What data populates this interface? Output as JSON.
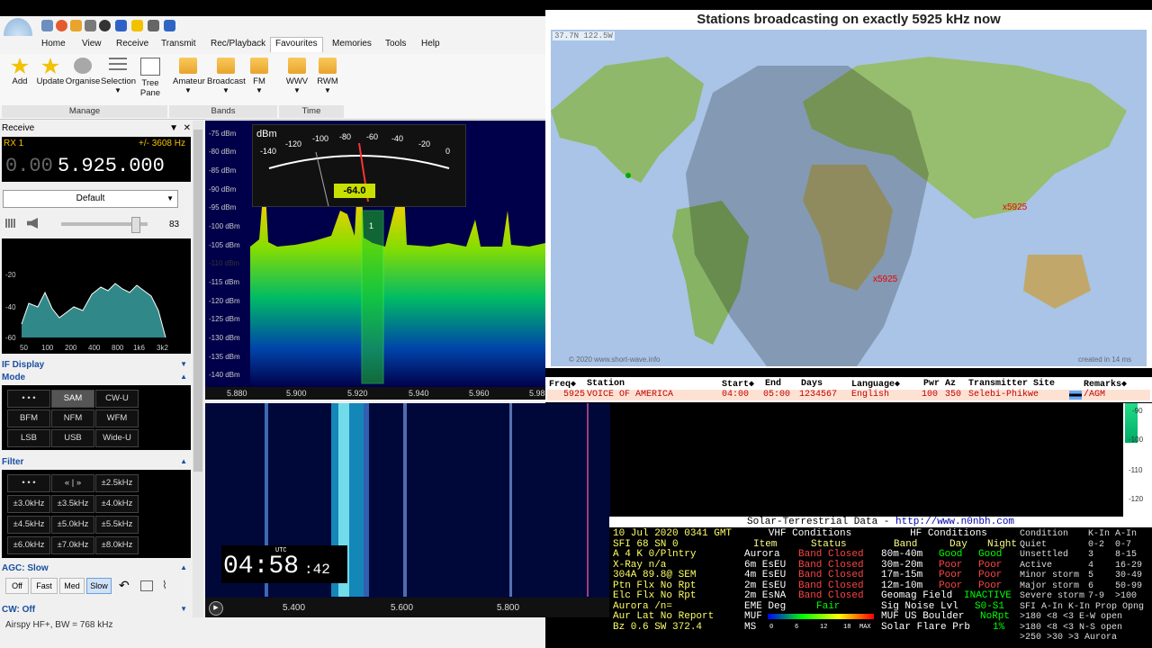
{
  "ribbon": {
    "tabs": [
      "Home",
      "View",
      "Receive",
      "Transmit",
      "Rec/Playback",
      "Favourites",
      "Memories",
      "Tools",
      "Help"
    ],
    "buttons": [
      {
        "label": "Add"
      },
      {
        "label": "Update"
      },
      {
        "label": "Organise"
      },
      {
        "label": "Selection"
      },
      {
        "label": "Tree Pane"
      },
      {
        "label": "Amateur"
      },
      {
        "label": "Broadcast"
      },
      {
        "label": "FM"
      },
      {
        "label": "WWV"
      },
      {
        "label": "RWM"
      }
    ],
    "groups": [
      "Manage",
      "Bands",
      "Time"
    ]
  },
  "receive": {
    "title": "Receive",
    "rx": "RX 1",
    "offset": "+/- 3608 Hz",
    "freq_dim": "0.00",
    "freq_main": "5.925.000",
    "profile": "Default",
    "volume": "83",
    "mini_y_labels": [
      "-20",
      "-40",
      "-60"
    ],
    "mini_x_labels": [
      "50",
      "100",
      "200",
      "400",
      "800",
      "1k6",
      "3k2"
    ]
  },
  "if_display": {
    "title": "IF Display"
  },
  "mode": {
    "title": "Mode",
    "buttons": [
      "• • •",
      "SAM",
      "CW-U",
      "BFM",
      "NFM",
      "WFM",
      "LSB",
      "USB",
      "Wide-U"
    ]
  },
  "filter": {
    "title": "Filter",
    "buttons": [
      "• • •",
      "« | »",
      "±2.5kHz",
      "±3.0kHz",
      "±3.5kHz",
      "±4.0kHz",
      "±4.5kHz",
      "±5.0kHz",
      "±5.5kHz",
      "±6.0kHz",
      "±7.0kHz",
      "±8.0kHz"
    ]
  },
  "agc": {
    "title": "AGC: Slow",
    "buttons": [
      "Off",
      "Fast",
      "Med",
      "Slow"
    ]
  },
  "cw": {
    "title": "CW: Off"
  },
  "statusbar": {
    "text": "Airspy HF+, BW = 768 kHz"
  },
  "spectrum": {
    "dbm_labels": [
      "-75 dBm",
      "-80 dBm",
      "-85 dBm",
      "-90 dBm",
      "-95 dBm",
      "-100 dBm",
      "-105 dBm",
      "-110 dBm",
      "-115 dBm",
      "-120 dBm",
      "-125 dBm",
      "-130 dBm",
      "-135 dBm",
      "-140 dBm"
    ],
    "freq_labels": [
      "5.880",
      "5.900",
      "5.920",
      "5.940",
      "5.960",
      "5.98"
    ],
    "meter_unit": "dBm",
    "meter_scale": [
      "-140",
      "-120",
      "-100",
      "-80",
      "-60",
      "-40",
      "-20",
      "0"
    ],
    "meter_value": "-64.0",
    "channel_marker": "1"
  },
  "waterfall": {
    "freq_labels": [
      "5.400",
      "5.600",
      "5.800"
    ],
    "scale_labels": [
      "-90",
      "-100",
      "-110",
      "-120"
    ]
  },
  "clock": {
    "utc": "UTC",
    "hhmm": "04:58",
    "ss": ":42"
  },
  "map": {
    "title": "Stations broadcasting on exactly 5925 kHz now",
    "coords": "37.7N 122.5W",
    "markers": [
      "x5925",
      "x5925"
    ],
    "credit": "© 2020 www.short-wave.info",
    "created": "created in 14 ms"
  },
  "station_table": {
    "headers": [
      "Freq◆",
      "Station",
      "Start◆",
      "End",
      "Days",
      "Language◆",
      "Pwr",
      "Az",
      "Transmitter Site",
      "Remarks◆"
    ],
    "row": [
      "5925",
      "VOICE OF AMERICA",
      "04:00",
      "05:00",
      "1234567",
      "English",
      "100",
      "350",
      "Selebi-Phikwe",
      "/AGM"
    ]
  },
  "solar": {
    "title": "Solar-Terrestrial Data - ",
    "url": "http://www.n0nbh.com",
    "left": [
      "10 Jul 2020 0341 GMT",
      "SFI 68   SN  0",
      "A  4  K  0/Plntry",
      "X-Ray   n/a",
      "304A  89.8@ SEM",
      "Ptn Flx  No Rpt",
      "Elc Flx  No Rpt",
      "Aurora   /n=",
      "Aur Lat  No Report",
      "Bz   0.6 SW 372.4"
    ],
    "vhf_title": "VHF Conditions",
    "vhf_headers": [
      "Item",
      "Status"
    ],
    "vhf_rows": [
      [
        "Aurora",
        "Band Closed"
      ],
      [
        "6m EsEU",
        "Band Closed"
      ],
      [
        "4m EsEU",
        "Band Closed"
      ],
      [
        "2m EsEU",
        "Band Closed"
      ],
      [
        "2m EsNA",
        "Band Closed"
      ]
    ],
    "eme": [
      "EME Deg",
      "Fair"
    ],
    "muf": "MUF",
    "ms": "MS",
    "muf_scale": [
      "0",
      "6",
      "12",
      "18",
      "MAX"
    ],
    "hf_title": "HF Conditions",
    "hf_headers": [
      "Band",
      "Day",
      "Night"
    ],
    "hf_rows": [
      [
        "80m-40m",
        "Good",
        "Good"
      ],
      [
        "30m-20m",
        "Poor",
        "Poor"
      ],
      [
        "17m-15m",
        "Poor",
        "Poor"
      ],
      [
        "12m-10m",
        "Poor",
        "Poor"
      ]
    ],
    "geomag": [
      "Geomag Field",
      "INACTIVE"
    ],
    "signoise": [
      "Sig Noise Lvl",
      "S0-S1"
    ],
    "muf_us": [
      "MUF US Boulder",
      "NoRpt"
    ],
    "solar_flare": [
      "Solar Flare Prb",
      "1%"
    ],
    "cond_headers": [
      "Condition",
      "K-In",
      "A-In"
    ],
    "cond_rows": [
      [
        "Quiet",
        "0-2",
        "0-7"
      ],
      [
        "Unsettled",
        "3",
        "8-15"
      ],
      [
        "Active",
        "4",
        "16-29"
      ],
      [
        "Minor storm",
        "5",
        "30-49"
      ],
      [
        "Major storm",
        "6",
        "50-99"
      ],
      [
        "Severe storm",
        "7-9",
        ">100"
      ]
    ],
    "sfi_headers": [
      "SFI A-In K-In Prop Opng"
    ],
    "sfi_rows": [
      ">180 <8  <3   E-W open",
      ">180 <8  <3   N-S open",
      ">250 >30 >3   Aurora"
    ]
  }
}
